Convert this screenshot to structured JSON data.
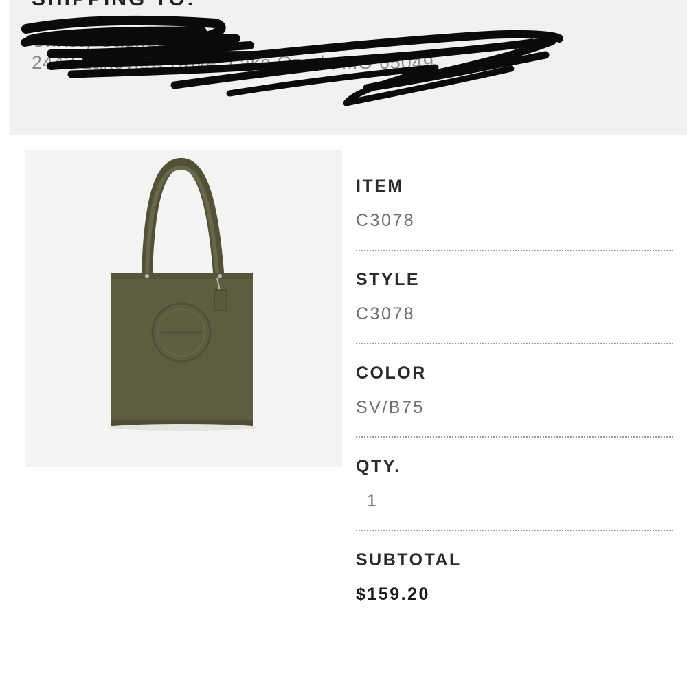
{
  "shipping": {
    "heading": "SHIPPING TO:",
    "name": "Christy Saunders",
    "address": "2443 Lakeview Drive, Lake Ozark, MO 65049"
  },
  "product": {
    "image_description_icon": "tote-bag-icon",
    "bag_color": "#5b5c40"
  },
  "details": {
    "item": {
      "label": "ITEM",
      "value": "C3078"
    },
    "style": {
      "label": "STYLE",
      "value": "C3078"
    },
    "color": {
      "label": "COLOR",
      "value": "SV/B75"
    },
    "qty": {
      "label": "QTY.",
      "value": "1"
    },
    "subtotal": {
      "label": "SUBTOTAL",
      "value": "$159.20"
    }
  }
}
